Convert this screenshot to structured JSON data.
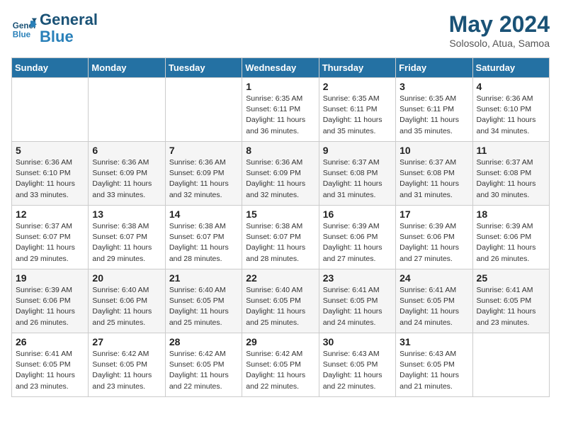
{
  "header": {
    "logo_line1": "General",
    "logo_line2": "Blue",
    "month_year": "May 2024",
    "location": "Solosolo, Atua, Samoa"
  },
  "days_of_week": [
    "Sunday",
    "Monday",
    "Tuesday",
    "Wednesday",
    "Thursday",
    "Friday",
    "Saturday"
  ],
  "weeks": [
    [
      {
        "day": "",
        "info": ""
      },
      {
        "day": "",
        "info": ""
      },
      {
        "day": "",
        "info": ""
      },
      {
        "day": "1",
        "info": "Sunrise: 6:35 AM\nSunset: 6:11 PM\nDaylight: 11 hours\nand 36 minutes."
      },
      {
        "day": "2",
        "info": "Sunrise: 6:35 AM\nSunset: 6:11 PM\nDaylight: 11 hours\nand 35 minutes."
      },
      {
        "day": "3",
        "info": "Sunrise: 6:35 AM\nSunset: 6:11 PM\nDaylight: 11 hours\nand 35 minutes."
      },
      {
        "day": "4",
        "info": "Sunrise: 6:36 AM\nSunset: 6:10 PM\nDaylight: 11 hours\nand 34 minutes."
      }
    ],
    [
      {
        "day": "5",
        "info": "Sunrise: 6:36 AM\nSunset: 6:10 PM\nDaylight: 11 hours\nand 33 minutes."
      },
      {
        "day": "6",
        "info": "Sunrise: 6:36 AM\nSunset: 6:09 PM\nDaylight: 11 hours\nand 33 minutes."
      },
      {
        "day": "7",
        "info": "Sunrise: 6:36 AM\nSunset: 6:09 PM\nDaylight: 11 hours\nand 32 minutes."
      },
      {
        "day": "8",
        "info": "Sunrise: 6:36 AM\nSunset: 6:09 PM\nDaylight: 11 hours\nand 32 minutes."
      },
      {
        "day": "9",
        "info": "Sunrise: 6:37 AM\nSunset: 6:08 PM\nDaylight: 11 hours\nand 31 minutes."
      },
      {
        "day": "10",
        "info": "Sunrise: 6:37 AM\nSunset: 6:08 PM\nDaylight: 11 hours\nand 31 minutes."
      },
      {
        "day": "11",
        "info": "Sunrise: 6:37 AM\nSunset: 6:08 PM\nDaylight: 11 hours\nand 30 minutes."
      }
    ],
    [
      {
        "day": "12",
        "info": "Sunrise: 6:37 AM\nSunset: 6:07 PM\nDaylight: 11 hours\nand 29 minutes."
      },
      {
        "day": "13",
        "info": "Sunrise: 6:38 AM\nSunset: 6:07 PM\nDaylight: 11 hours\nand 29 minutes."
      },
      {
        "day": "14",
        "info": "Sunrise: 6:38 AM\nSunset: 6:07 PM\nDaylight: 11 hours\nand 28 minutes."
      },
      {
        "day": "15",
        "info": "Sunrise: 6:38 AM\nSunset: 6:07 PM\nDaylight: 11 hours\nand 28 minutes."
      },
      {
        "day": "16",
        "info": "Sunrise: 6:39 AM\nSunset: 6:06 PM\nDaylight: 11 hours\nand 27 minutes."
      },
      {
        "day": "17",
        "info": "Sunrise: 6:39 AM\nSunset: 6:06 PM\nDaylight: 11 hours\nand 27 minutes."
      },
      {
        "day": "18",
        "info": "Sunrise: 6:39 AM\nSunset: 6:06 PM\nDaylight: 11 hours\nand 26 minutes."
      }
    ],
    [
      {
        "day": "19",
        "info": "Sunrise: 6:39 AM\nSunset: 6:06 PM\nDaylight: 11 hours\nand 26 minutes."
      },
      {
        "day": "20",
        "info": "Sunrise: 6:40 AM\nSunset: 6:06 PM\nDaylight: 11 hours\nand 25 minutes."
      },
      {
        "day": "21",
        "info": "Sunrise: 6:40 AM\nSunset: 6:05 PM\nDaylight: 11 hours\nand 25 minutes."
      },
      {
        "day": "22",
        "info": "Sunrise: 6:40 AM\nSunset: 6:05 PM\nDaylight: 11 hours\nand 25 minutes."
      },
      {
        "day": "23",
        "info": "Sunrise: 6:41 AM\nSunset: 6:05 PM\nDaylight: 11 hours\nand 24 minutes."
      },
      {
        "day": "24",
        "info": "Sunrise: 6:41 AM\nSunset: 6:05 PM\nDaylight: 11 hours\nand 24 minutes."
      },
      {
        "day": "25",
        "info": "Sunrise: 6:41 AM\nSunset: 6:05 PM\nDaylight: 11 hours\nand 23 minutes."
      }
    ],
    [
      {
        "day": "26",
        "info": "Sunrise: 6:41 AM\nSunset: 6:05 PM\nDaylight: 11 hours\nand 23 minutes."
      },
      {
        "day": "27",
        "info": "Sunrise: 6:42 AM\nSunset: 6:05 PM\nDaylight: 11 hours\nand 23 minutes."
      },
      {
        "day": "28",
        "info": "Sunrise: 6:42 AM\nSunset: 6:05 PM\nDaylight: 11 hours\nand 22 minutes."
      },
      {
        "day": "29",
        "info": "Sunrise: 6:42 AM\nSunset: 6:05 PM\nDaylight: 11 hours\nand 22 minutes."
      },
      {
        "day": "30",
        "info": "Sunrise: 6:43 AM\nSunset: 6:05 PM\nDaylight: 11 hours\nand 22 minutes."
      },
      {
        "day": "31",
        "info": "Sunrise: 6:43 AM\nSunset: 6:05 PM\nDaylight: 11 hours\nand 21 minutes."
      },
      {
        "day": "",
        "info": ""
      }
    ]
  ]
}
